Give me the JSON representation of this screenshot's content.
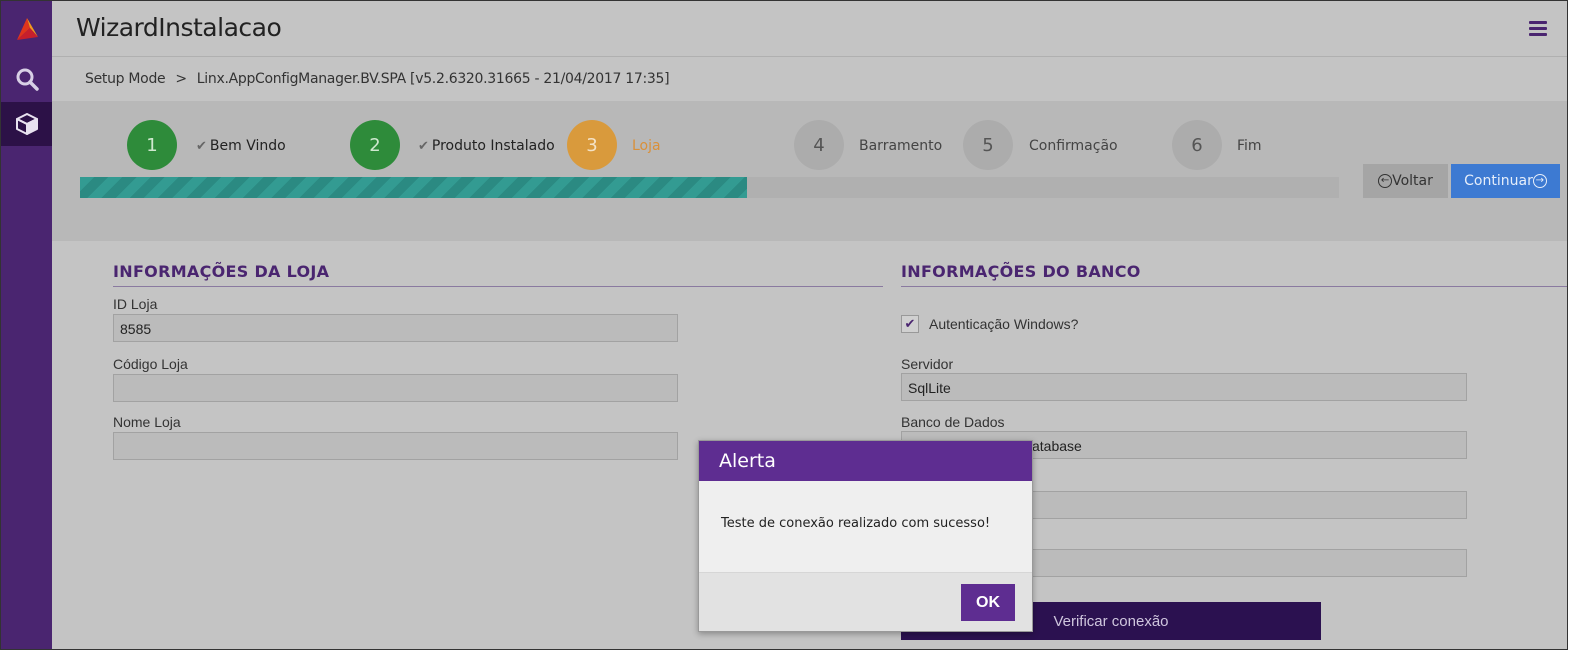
{
  "app": {
    "title": "WizardInstalacao"
  },
  "breadcrumb": {
    "root": "Setup Mode",
    "separator": ">",
    "current": "Linx.AppConfigManager.BV.SPA [v5.2.6320.31665 - 21/04/2017 17:35]"
  },
  "wizard": {
    "steps": [
      {
        "number": "1",
        "label": "Bem Vindo",
        "state": "done"
      },
      {
        "number": "2",
        "label": "Produto Instalado",
        "state": "done"
      },
      {
        "number": "3",
        "label": "Loja",
        "state": "current"
      },
      {
        "number": "4",
        "label": "Barramento",
        "state": "todo"
      },
      {
        "number": "5",
        "label": "Confirmação",
        "state": "todo"
      },
      {
        "number": "6",
        "label": "Fim",
        "state": "todo"
      }
    ],
    "progress_percent": 53,
    "back_label": "Voltar",
    "next_label": "Continuar"
  },
  "store_info": {
    "title": "INFORMAÇÕES DA LOJA",
    "id_label": "ID Loja",
    "id_value": "8585",
    "code_label": "Código Loja",
    "code_value": "",
    "name_label": "Nome Loja",
    "name_value": ""
  },
  "db_info": {
    "title": "INFORMAÇÕES DO BANCO",
    "windows_auth_label": "Autenticação Windows?",
    "windows_auth_checked": true,
    "server_label": "Servidor",
    "server_value": "SqlLite",
    "database_label": "Banco de Dados",
    "database_value_visible": "atabase",
    "verify_label": "Verificar conexão"
  },
  "alert": {
    "title": "Alerta",
    "message": "Teste de conexão realizado com sucesso!",
    "ok_label": "OK"
  },
  "colors": {
    "sidebar": "#4a2570",
    "accent": "#5e2d91",
    "done": "#2e8b3a",
    "current": "#d99a3c",
    "primary": "#3d7ad2"
  }
}
